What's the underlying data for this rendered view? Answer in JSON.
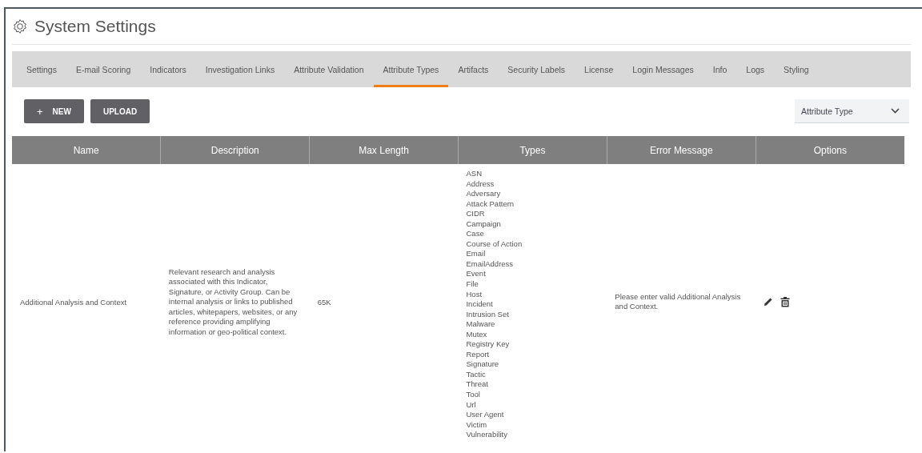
{
  "page": {
    "title": "System Settings"
  },
  "tabs": [
    {
      "label": "Settings",
      "selected": false
    },
    {
      "label": "E-mail Scoring",
      "selected": false
    },
    {
      "label": "Indicators",
      "selected": false
    },
    {
      "label": "Investigation Links",
      "selected": false
    },
    {
      "label": "Attribute Validation",
      "selected": false
    },
    {
      "label": "Attribute Types",
      "selected": true
    },
    {
      "label": "Artifacts",
      "selected": false
    },
    {
      "label": "Security Labels",
      "selected": false
    },
    {
      "label": "License",
      "selected": false
    },
    {
      "label": "Login Messages",
      "selected": false
    },
    {
      "label": "Info",
      "selected": false
    },
    {
      "label": "Logs",
      "selected": false
    },
    {
      "label": "Styling",
      "selected": false
    }
  ],
  "toolbar": {
    "new_button": {
      "icon": "+",
      "label": "NEW"
    },
    "upload_button": "UPLOAD",
    "filter_select": {
      "value": "Attribute Type"
    }
  },
  "table": {
    "columns": [
      "Name",
      "Description",
      "Max Length",
      "Types",
      "Error Message",
      "Options"
    ],
    "rows": [
      {
        "name": "Additional Analysis and Context",
        "description": "Relevant research and analysis associated with this Indicator, Signature, or Activity Group. Can be internal analysis or links to published articles, whitepapers, websites, or any reference providing amplifying information or geo-political context.",
        "max_length": "65K",
        "types": [
          "ASN",
          "Address",
          "Adversary",
          "Attack Pattern",
          "CIDR",
          "Campaign",
          "Case",
          "Course of Action",
          "Email",
          "EmailAddress",
          "Event",
          "File",
          "Host",
          "Incident",
          "Intrusion Set",
          "Malware",
          "Mutex",
          "Registry Key",
          "Report",
          "Signature",
          "Tactic",
          "Threat",
          "Tool",
          "Url",
          "User Agent",
          "Victim",
          "Vulnerability"
        ],
        "error_message": "Please enter valid Additional Analysis and Context."
      }
    ]
  }
}
